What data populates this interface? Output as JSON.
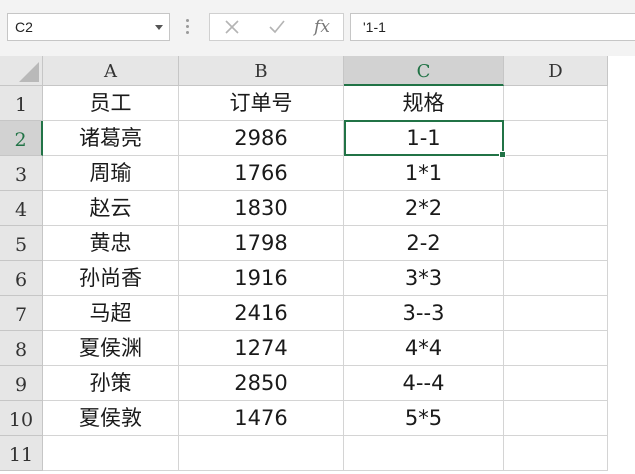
{
  "name_box": {
    "value": "C2"
  },
  "formula_bar": {
    "cancel_glyph": "✕",
    "enter_glyph": "✓",
    "fx_label": "fx",
    "content": "'1-1"
  },
  "columns": [
    {
      "label": "A",
      "selected": false
    },
    {
      "label": "B",
      "selected": false
    },
    {
      "label": "C",
      "selected": true
    },
    {
      "label": "D",
      "selected": false
    }
  ],
  "rows": [
    {
      "num": "1",
      "cells": [
        "员工",
        "订单号",
        "规格",
        ""
      ]
    },
    {
      "num": "2",
      "cells": [
        "诸葛亮",
        "2986",
        "1-1",
        ""
      ]
    },
    {
      "num": "3",
      "cells": [
        "周瑜",
        "1766",
        "1*1",
        ""
      ]
    },
    {
      "num": "4",
      "cells": [
        "赵云",
        "1830",
        "2*2",
        ""
      ]
    },
    {
      "num": "5",
      "cells": [
        "黄忠",
        "1798",
        "2-2",
        ""
      ]
    },
    {
      "num": "6",
      "cells": [
        "孙尚香",
        "1916",
        "3*3",
        ""
      ]
    },
    {
      "num": "7",
      "cells": [
        "马超",
        "2416",
        "3--3",
        ""
      ]
    },
    {
      "num": "8",
      "cells": [
        "夏侯渊",
        "1274",
        "4*4",
        ""
      ]
    },
    {
      "num": "9",
      "cells": [
        "孙策",
        "2850",
        "4--4",
        ""
      ]
    },
    {
      "num": "10",
      "cells": [
        "夏侯敦",
        "1476",
        "5*5",
        ""
      ]
    },
    {
      "num": "11",
      "cells": [
        "",
        "",
        "",
        ""
      ]
    }
  ],
  "active_cell": {
    "row": "2",
    "col": "C"
  },
  "colors": {
    "accent": "#217346",
    "header_bg": "#e6e6e6",
    "header_selected_bg": "#d2d2d2",
    "gridline": "#d4d4d4"
  }
}
